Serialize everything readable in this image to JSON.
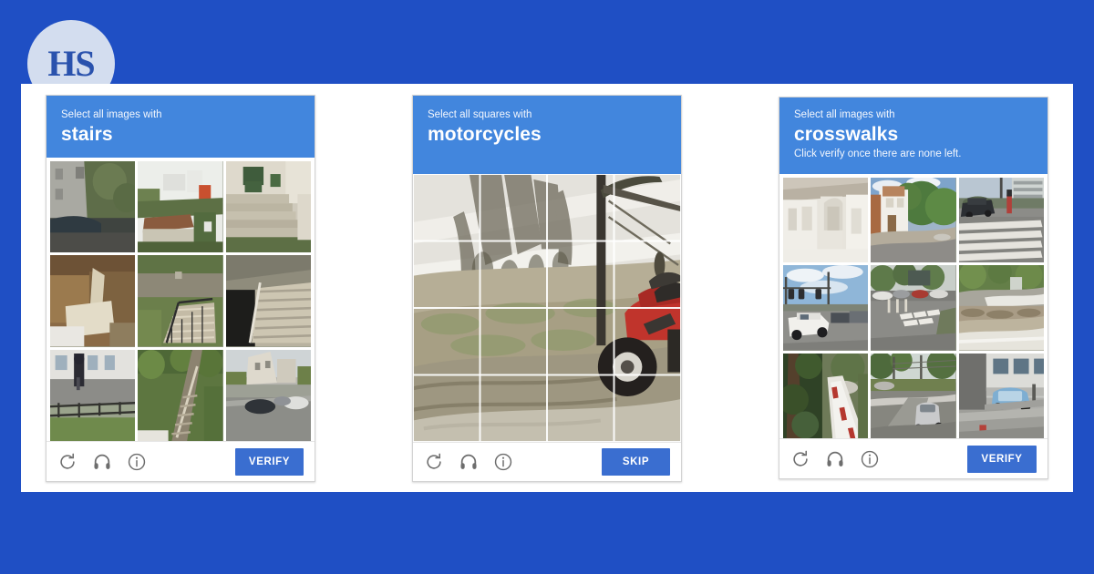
{
  "brand": {
    "logo_text": "HS",
    "logo_color": "#2a52ad",
    "circle_color": "#d3ddef"
  },
  "theme": {
    "page_background": "#1f4fc4",
    "card_background": "#ffffff",
    "header_blue": "#4286dd",
    "button_blue": "#3a6ed0",
    "icon_gray": "#6d6d6d"
  },
  "captchas": [
    {
      "id": "stairs",
      "prompt": "Select all images with",
      "target": "stairs",
      "hint": "",
      "grid_type": "3x3-tiles",
      "button_label": "VERIFY",
      "icons": [
        "refresh-icon",
        "audio-icon",
        "info-icon"
      ],
      "tiles": [
        "apartment building with parked car",
        "rooftops and white house behind hedge",
        "green chair on concrete steps",
        "wooden shed with leaning boards",
        "stone staircase with iron railing on lawn",
        "wide concrete stairs beside underpass",
        "person walking on street by fence",
        "long stairway through green garden",
        "suburban street with parked cars"
      ]
    },
    {
      "id": "motorcycles",
      "prompt": "Select all squares with",
      "target": "motorcycles",
      "hint": "",
      "grid_type": "4x4-overlay",
      "button_label": "SKIP",
      "icons": [
        "refresh-icon",
        "audio-icon",
        "info-icon"
      ],
      "photo_description": "dirt slope with tree trunk, utility pole and red motorcycle parked at bottom right"
    },
    {
      "id": "crosswalks",
      "prompt": "Select all images with",
      "target": "crosswalks",
      "hint": "Click verify once there are none left.",
      "grid_type": "3x3-tiles",
      "button_label": "VERIFY",
      "icons": [
        "refresh-icon",
        "audio-icon",
        "info-icon"
      ],
      "tiles": [
        "white building facade with balcony",
        "white house with trees and driveway",
        "zebra crossing with dark car and pedestrian",
        "intersection with traffic lights and white SUV",
        "crosswalk markings on boulevard",
        "road curve with landscaped median",
        "guardrail beside trees",
        "two-lane road with silver minivan",
        "blue car parked beside building"
      ]
    }
  ]
}
